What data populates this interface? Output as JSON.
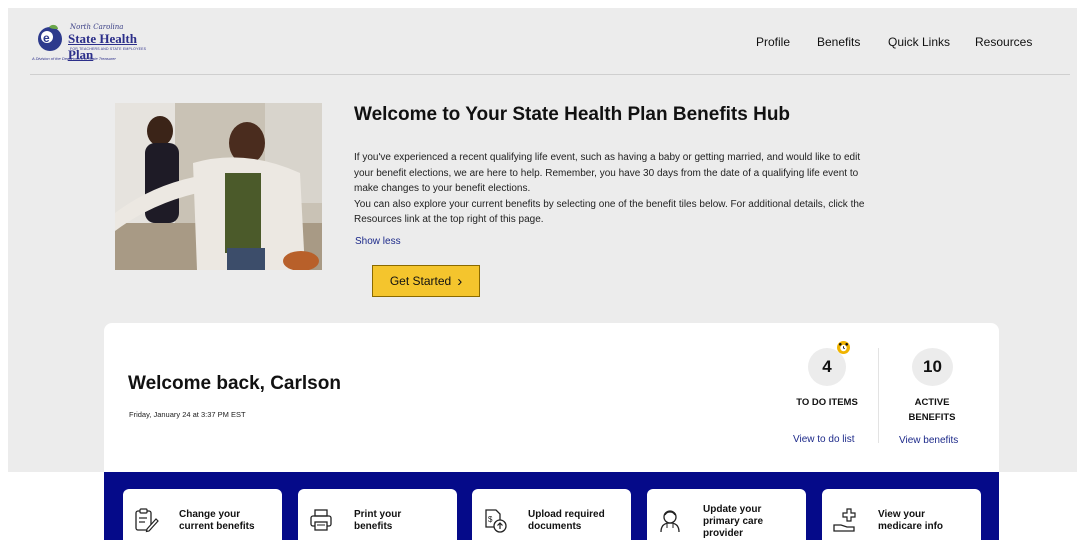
{
  "logo": {
    "script_text": "North Carolina",
    "name": "State Health Plan",
    "subtext": "FOR TEACHERS AND STATE EMPLOYEES",
    "division": "A Division of the Department of State Treasurer"
  },
  "nav": {
    "items": [
      "Profile",
      "Benefits",
      "Quick Links",
      "Resources"
    ]
  },
  "hero": {
    "title": "Welcome to Your State Health Plan Benefits Hub",
    "paragraphs": [
      "If you've experienced a recent qualifying life event, such as having a baby or getting married, and would like to edit your benefit elections, we are here to help. Remember, you have 30 days from the date of a qualifying life event to make changes to your benefit elections.",
      "You can also explore your current benefits by selecting one of the benefit tiles below. For additional details, click the Resources link at the top right of this page."
    ],
    "show_less": "Show less",
    "cta": "Get Started",
    "cta_chevron": "›"
  },
  "welcome": {
    "title": "Welcome back, Carlson",
    "date": "Friday, January 24 at 3:37 PM EST"
  },
  "stats": {
    "todo": {
      "count": "4",
      "label_line1": "TO DO ITEMS",
      "link": "View to do list",
      "badge_icon": "alarm-clock-icon"
    },
    "active": {
      "count": "10",
      "label_line1": "ACTIVE",
      "label_line2": "BENEFITS",
      "link": "View benefits"
    }
  },
  "tiles": [
    {
      "icon": "clipboard-edit-icon",
      "line1": "Change your",
      "line2": "current benefits",
      "line3": ""
    },
    {
      "icon": "printer-icon",
      "line1": "Print your",
      "line2": "benefits",
      "line3": ""
    },
    {
      "icon": "document-upload-icon",
      "line1": "Upload required",
      "line2": "documents",
      "line3": ""
    },
    {
      "icon": "doctor-icon",
      "line1": "Update your",
      "line2": "primary care",
      "line3": "provider"
    },
    {
      "icon": "medical-hand-icon",
      "line1": "View your",
      "line2": "medicare info",
      "line3": ""
    }
  ],
  "colors": {
    "accent_yellow": "#f4c52d",
    "band_navy": "#050a89",
    "link_blue": "#1d2a8a",
    "page_gray": "#ececec"
  }
}
